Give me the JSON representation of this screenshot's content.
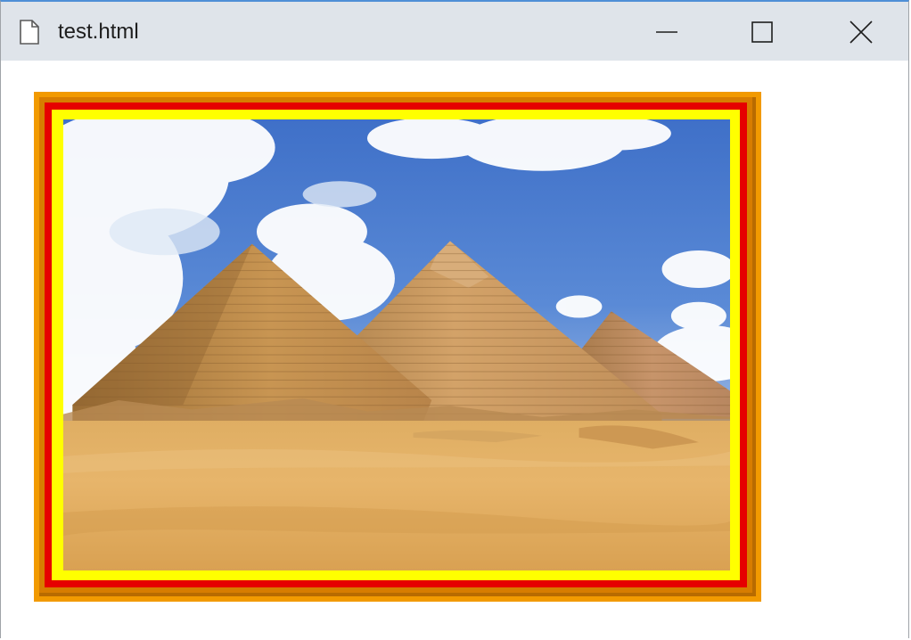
{
  "window": {
    "title": "test.html",
    "icons": {
      "document": "document-icon",
      "minimize": "minimize-icon",
      "maximize": "maximize-icon",
      "close": "close-icon"
    }
  },
  "frame": {
    "colors": {
      "outer": "#f29a00",
      "ridge": "#d77d00",
      "red": "#e60000",
      "yellow": "#ffff00"
    }
  }
}
